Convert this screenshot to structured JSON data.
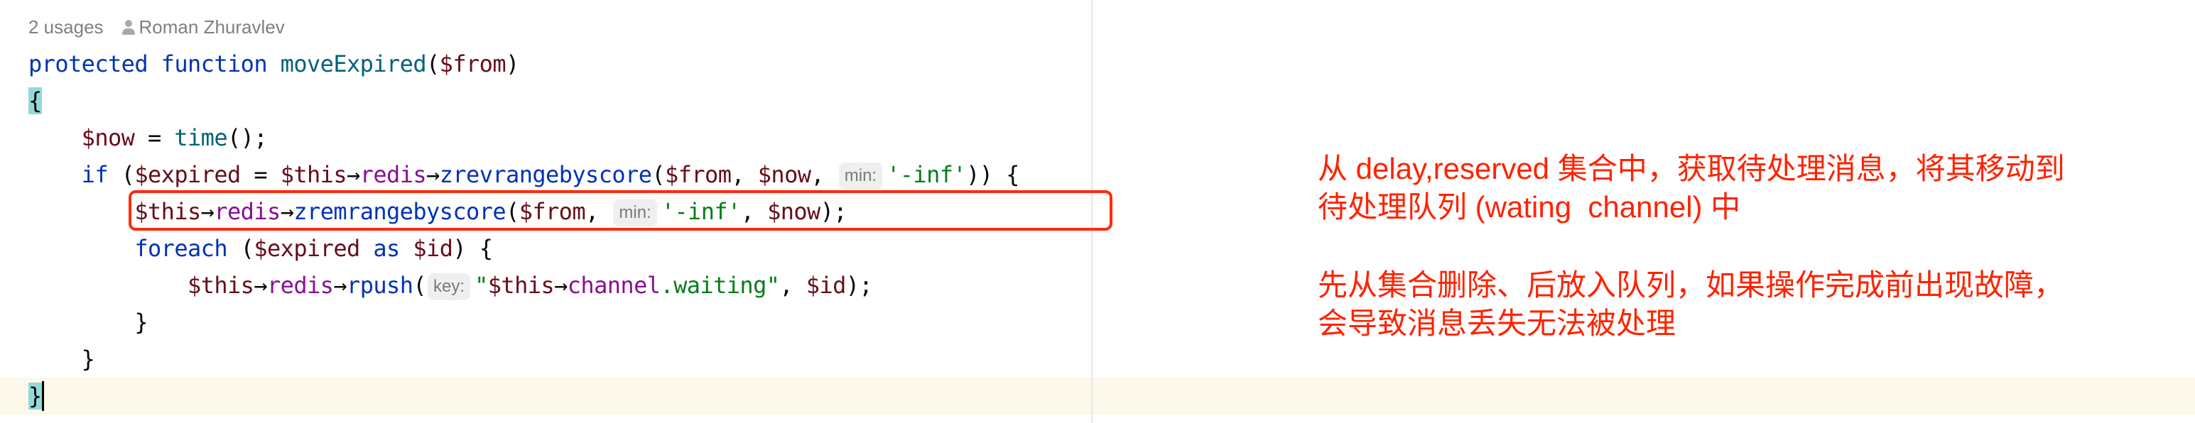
{
  "editor": {
    "usages": "2 usages",
    "author": "Roman Zhuravlev",
    "author_icon": "person-icon",
    "code_lines": [
      [
        {
          "t": "protected",
          "c": "kw"
        },
        {
          "t": " "
        },
        {
          "t": "function",
          "c": "kw"
        },
        {
          "t": " "
        },
        {
          "t": "moveExpired",
          "c": "fn"
        },
        {
          "t": "("
        },
        {
          "t": "$from",
          "c": "var"
        },
        {
          "t": ")"
        }
      ],
      [
        {
          "t": "{",
          "c": "brace-hl"
        }
      ],
      [
        {
          "t": "    "
        },
        {
          "t": "$now",
          "c": "var"
        },
        {
          "t": " = "
        },
        {
          "t": "time",
          "c": "fn"
        },
        {
          "t": "();"
        }
      ],
      [
        {
          "t": "    "
        },
        {
          "t": "if",
          "c": "kw"
        },
        {
          "t": " ("
        },
        {
          "t": "$expired",
          "c": "var"
        },
        {
          "t": " = "
        },
        {
          "t": "$this",
          "c": "var"
        },
        {
          "t": "→"
        },
        {
          "t": "redis",
          "c": "prop"
        },
        {
          "t": "→"
        },
        {
          "t": "zrevrangebyscore",
          "c": "call"
        },
        {
          "t": "("
        },
        {
          "t": "$from",
          "c": "var"
        },
        {
          "t": ", "
        },
        {
          "t": "$now",
          "c": "var"
        },
        {
          "t": ", "
        },
        {
          "t": "min:",
          "c": "hint"
        },
        {
          "t": "'-inf'",
          "c": "str"
        },
        {
          "t": ")) {"
        }
      ],
      [
        {
          "t": "        "
        },
        {
          "t": "$this",
          "c": "var"
        },
        {
          "t": "→"
        },
        {
          "t": "redis",
          "c": "prop"
        },
        {
          "t": "→"
        },
        {
          "t": "zremrangebyscore",
          "c": "call"
        },
        {
          "t": "("
        },
        {
          "t": "$from",
          "c": "var"
        },
        {
          "t": ", "
        },
        {
          "t": "min:",
          "c": "hint"
        },
        {
          "t": "'-inf'",
          "c": "str"
        },
        {
          "t": ", "
        },
        {
          "t": "$now",
          "c": "var"
        },
        {
          "t": ");"
        }
      ],
      [
        {
          "t": "        "
        },
        {
          "t": "foreach",
          "c": "kw"
        },
        {
          "t": " ("
        },
        {
          "t": "$expired",
          "c": "var"
        },
        {
          "t": " "
        },
        {
          "t": "as",
          "c": "kw"
        },
        {
          "t": " "
        },
        {
          "t": "$id",
          "c": "var"
        },
        {
          "t": ") {"
        }
      ],
      [
        {
          "t": "            "
        },
        {
          "t": "$this",
          "c": "var"
        },
        {
          "t": "→"
        },
        {
          "t": "redis",
          "c": "prop"
        },
        {
          "t": "→"
        },
        {
          "t": "rpush",
          "c": "call"
        },
        {
          "t": "("
        },
        {
          "t": "key:",
          "c": "hint"
        },
        {
          "t": "\"",
          "c": "str"
        },
        {
          "t": "$this",
          "c": "var"
        },
        {
          "t": "→"
        },
        {
          "t": "channel",
          "c": "prop"
        },
        {
          "t": ".waiting\"",
          "c": "str"
        },
        {
          "t": ", "
        },
        {
          "t": "$id",
          "c": "var"
        },
        {
          "t": ");"
        }
      ],
      [
        {
          "t": "        }"
        }
      ],
      [
        {
          "t": "    }"
        }
      ],
      [
        {
          "t": "}",
          "c": "brace-hl"
        },
        {
          "t": "",
          "c": "caret"
        }
      ]
    ]
  },
  "annotation": {
    "color": "#ff2200",
    "paragraph1": [
      "从 delay,reserved 集合中，获取待处理消息，将其移动到",
      "待处理队列 (wating  channel) 中"
    ],
    "paragraph2": [
      "先从集合删除、后放入队列，如果操作完成前出现故障，",
      "会导致消息丢失无法被处理"
    ]
  }
}
